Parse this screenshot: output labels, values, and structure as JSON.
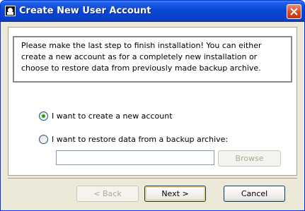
{
  "window": {
    "title": "Create New User Account"
  },
  "info": {
    "text": "Please make the last step to finish installation! You can either create a new account as for a completely new installation or choose to restore data from previously made backup archive."
  },
  "options": {
    "create_label": "I want to create a new account",
    "create_checked": true,
    "restore_label": "I want to restore data from a backup archive:",
    "restore_checked": false
  },
  "backup_path": {
    "value": ""
  },
  "buttons": {
    "browse_label": "Browse",
    "back_label": "< Back",
    "next_label": "Next  >",
    "cancel_label": "Cancel"
  }
}
